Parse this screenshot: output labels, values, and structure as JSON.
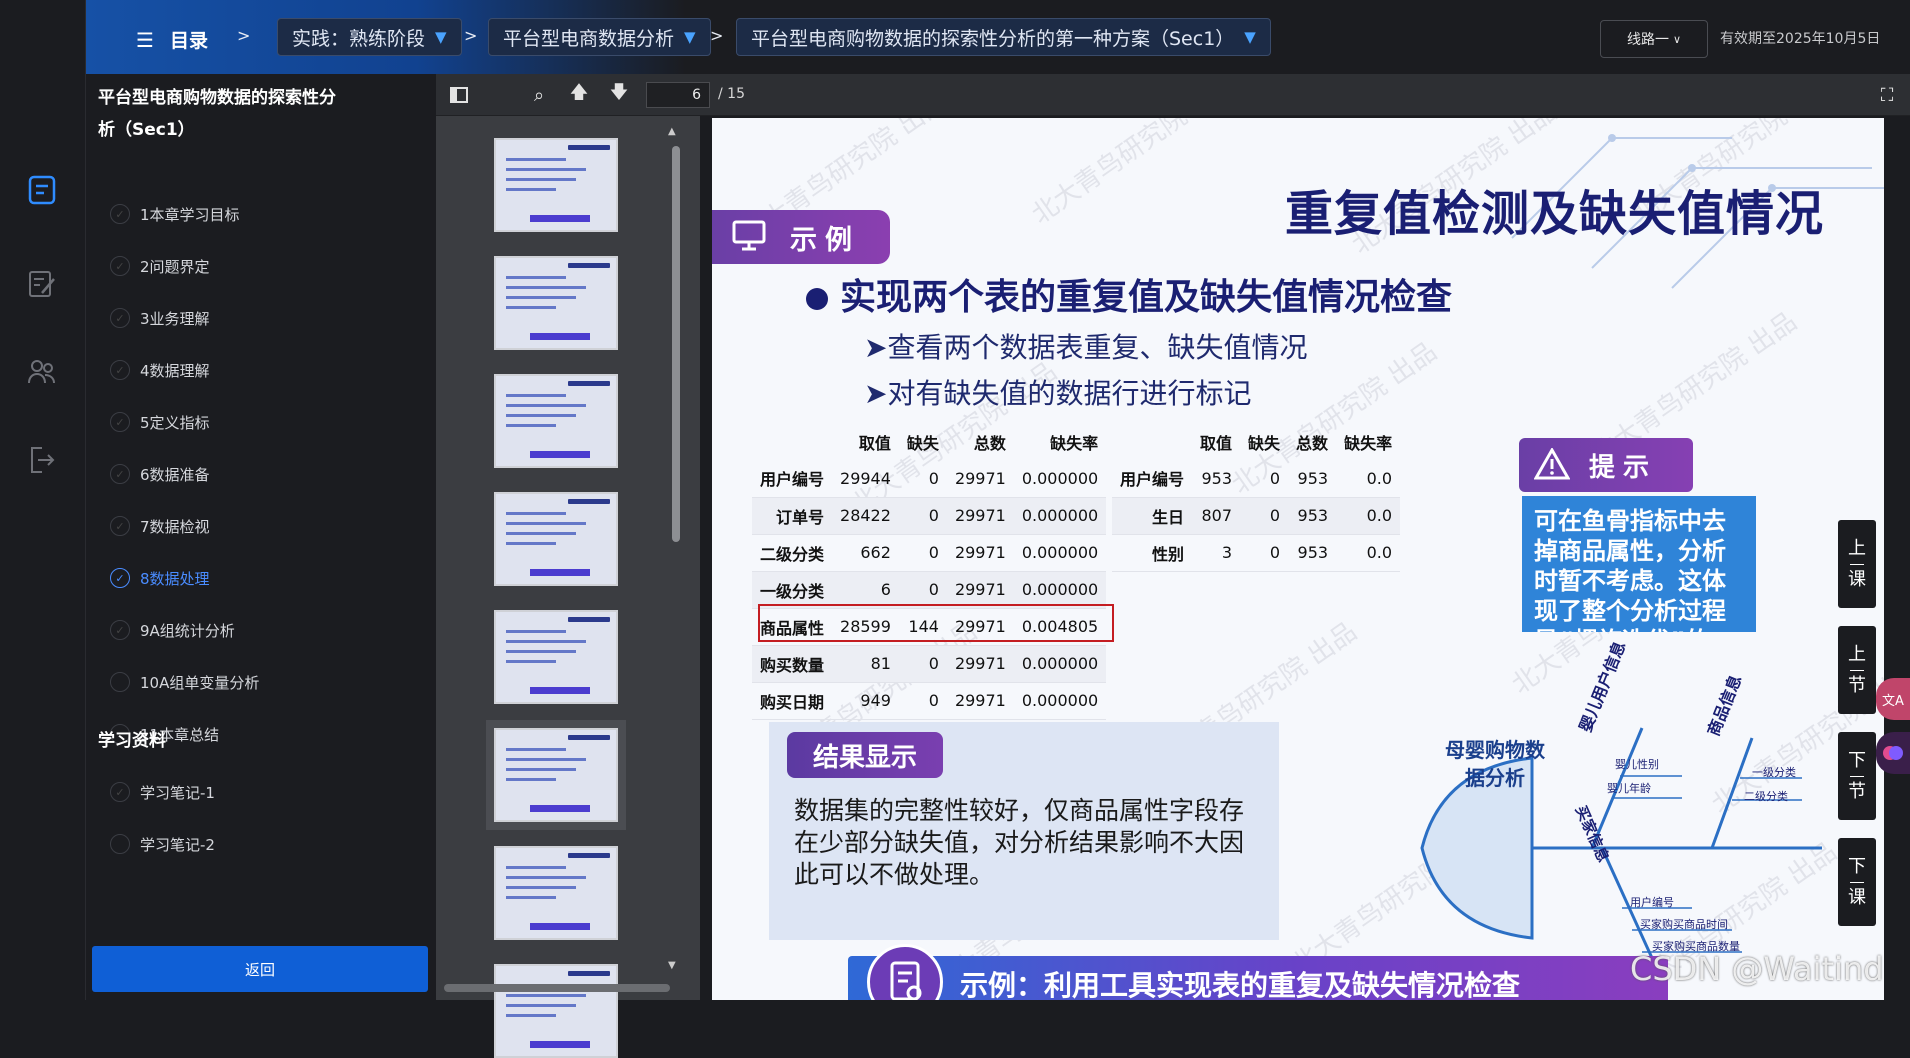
{
  "topbar": {
    "menu_label": "目录",
    "breadcrumbs": [
      {
        "label": "实践：熟练阶段"
      },
      {
        "label": "平台型电商数据分析"
      },
      {
        "label": "平台型电商购物数据的探索性分析的第一种方案（Sec1）"
      }
    ],
    "route_button": "线路一",
    "expiry": "有效期至2025年10月5日"
  },
  "chapters": {
    "title_line1": "平台型电商购物数据的探索性分",
    "title_line2": "析（Sec1）",
    "items": [
      {
        "label": "1本章学习目标",
        "active": false
      },
      {
        "label": "2问题界定",
        "active": false
      },
      {
        "label": "3业务理解",
        "active": false
      },
      {
        "label": "4数据理解",
        "active": false
      },
      {
        "label": "5定义指标",
        "active": false
      },
      {
        "label": "6数据准备",
        "active": false
      },
      {
        "label": "7数据检视",
        "active": false
      },
      {
        "label": "8数据处理",
        "active": true
      },
      {
        "label": "9A组统计分析",
        "active": false
      },
      {
        "label": "10A组单变量分析",
        "active": false
      },
      {
        "label": "11本章总结",
        "active": false
      }
    ],
    "materials_title": "学习资料",
    "materials": [
      {
        "label": "学习笔记-1"
      },
      {
        "label": "学习笔记-2"
      }
    ],
    "back_label": "返回"
  },
  "pdf": {
    "page": "6",
    "total": "/ 15"
  },
  "slide": {
    "title": "重复值检测及缺失值情况",
    "example_badge": "示例",
    "heading": "实现两个表的重复值及缺失值情况检查",
    "sub1": "➤查看两个数据表重复、缺失值情况",
    "sub2": "➤对有缺失值的数据行进行标记",
    "table1": {
      "headers": [
        "",
        "取值",
        "缺失",
        "总数",
        "缺失率"
      ],
      "rows": [
        [
          "用户编号",
          "29944",
          "0",
          "29971",
          "0.000000"
        ],
        [
          "订单号",
          "28422",
          "0",
          "29971",
          "0.000000"
        ],
        [
          "二级分类",
          "662",
          "0",
          "29971",
          "0.000000"
        ],
        [
          "一级分类",
          "6",
          "0",
          "29971",
          "0.000000"
        ],
        [
          "商品属性",
          "28599",
          "144",
          "29971",
          "0.004805"
        ],
        [
          "购买数量",
          "81",
          "0",
          "29971",
          "0.000000"
        ],
        [
          "购买日期",
          "949",
          "0",
          "29971",
          "0.000000"
        ]
      ]
    },
    "table2": {
      "headers": [
        "",
        "取值",
        "缺失",
        "总数",
        "缺失率"
      ],
      "rows": [
        [
          "用户编号",
          "953",
          "0",
          "953",
          "0.0"
        ],
        [
          "生日",
          "807",
          "0",
          "953",
          "0.0"
        ],
        [
          "性别",
          "3",
          "0",
          "953",
          "0.0"
        ]
      ]
    },
    "result_badge": "结果显示",
    "result_text": "数据集的完整性较好，仅商品属性字段存在少部分缺失值，对分析结果影响不大因此可以不做处理。",
    "tip_badge": "提示",
    "tip_text": "可在鱼骨指标中去掉商品属性，分析时暂不考虑。这体现了整个分析过程是“螺旋迭代”的",
    "fish": {
      "head": "母婴购物数据分析",
      "branch_user": "婴儿用户信息",
      "branch_goods": "商品信息",
      "branch_buyer": "买家信息",
      "leaf1": "婴儿性别",
      "leaf2": "婴儿年龄",
      "leaf3": "一级分类",
      "leaf4": "二级分类",
      "leaf5": "用户编号",
      "leaf6": "买家购买商品时间",
      "leaf7": "买家购买商品数量"
    },
    "banner": "示例：利用工具实现表的重复及缺失情况检查",
    "watermark": "北大青鸟研究院 出品"
  },
  "rnav": {
    "prev_lesson": [
      "上",
      "课"
    ],
    "prev_section": [
      "上",
      "节"
    ],
    "next_section": [
      "下",
      "节"
    ],
    "next_lesson": [
      "下",
      "课"
    ]
  },
  "footer_watermark": "CSDN @Waitind",
  "colors": {
    "accent": "#0f5fd6",
    "active": "#4a8cff",
    "slide_title": "#1a1f73",
    "highlight": "#c41d22"
  }
}
